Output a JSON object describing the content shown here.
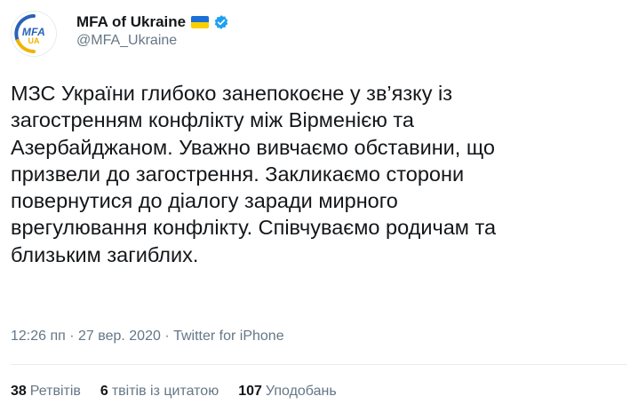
{
  "header": {
    "display_name": "MFA of Ukraine",
    "handle": "@MFA_Ukraine",
    "avatar": {
      "line1": "MFA",
      "line2": "UA"
    },
    "flag_colors": [
      "#1c6fd6",
      "#f8d000"
    ],
    "verified_color": "#1da1f2"
  },
  "tweet": {
    "text": "МЗС України глибоко занепокоєне у зв’язку із\nзагостренням конфлікту між Вірменією та\nАзербайджаном. Уважно вивчаємо обставини, що\nпризвели до загострення. Закликаємо сторони\nповернутися до діалогу заради мирного\nврегулювання конфлікту. Співчуваємо родичам та\nблизьким загиблих."
  },
  "meta": {
    "time": "12:26 пп",
    "separator1": " · ",
    "date": "27 вер. 2020",
    "separator2": " · ",
    "source": "Twitter for iPhone"
  },
  "stats": {
    "retweets_count": "38",
    "retweets_label": "Ретвітів",
    "quotes_count": "6",
    "quotes_label": "твітів із цитатою",
    "likes_count": "107",
    "likes_label": "Уподобань"
  }
}
